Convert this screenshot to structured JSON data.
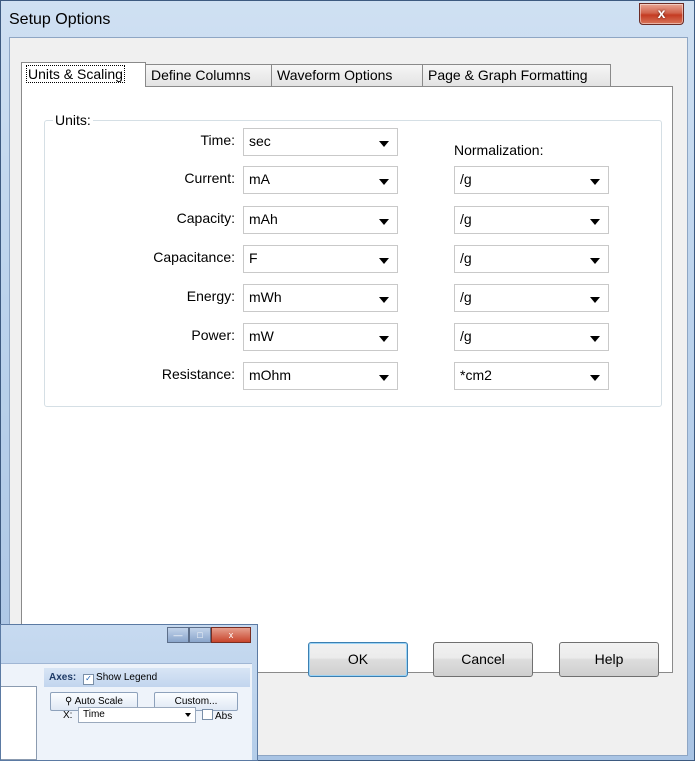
{
  "window": {
    "title": "Setup Options",
    "close_glyph": "x"
  },
  "tabs": [
    {
      "label": "Units & Scaling",
      "active": true
    },
    {
      "label": "Define Columns",
      "active": false
    },
    {
      "label": "Waveform Options",
      "active": false
    },
    {
      "label": "Page & Graph Formatting",
      "active": false
    }
  ],
  "units": {
    "group_label": "Units:",
    "normalization_label": "Normalization:",
    "rows": [
      {
        "label": "Time:",
        "value": "sec",
        "normalization": null
      },
      {
        "label": "Current:",
        "value": "mA",
        "normalization": "/g"
      },
      {
        "label": "Capacity:",
        "value": "mAh",
        "normalization": "/g"
      },
      {
        "label": "Capacitance:",
        "value": "F",
        "normalization": "/g"
      },
      {
        "label": "Energy:",
        "value": "mWh",
        "normalization": "/g"
      },
      {
        "label": "Power:",
        "value": "mW",
        "normalization": "/g"
      },
      {
        "label": "Resistance:",
        "value": "mOhm",
        "normalization": "*cm2"
      }
    ]
  },
  "buttons": {
    "ok": "OK",
    "cancel": "Cancel",
    "help": "Help"
  },
  "background_window": {
    "axes_label": "Axes:",
    "show_legend": "Show Legend",
    "show_legend_checked": true,
    "auto_scale": "Auto Scale",
    "custom": "Custom...",
    "x_label": "X:",
    "x_value": "Time",
    "abs_label": "Abs",
    "abs_checked": false
  },
  "icons": [
    "close-icon",
    "dropdown-arrow-icon",
    "magnifier-icon",
    "minimize-icon",
    "maximize-icon"
  ]
}
